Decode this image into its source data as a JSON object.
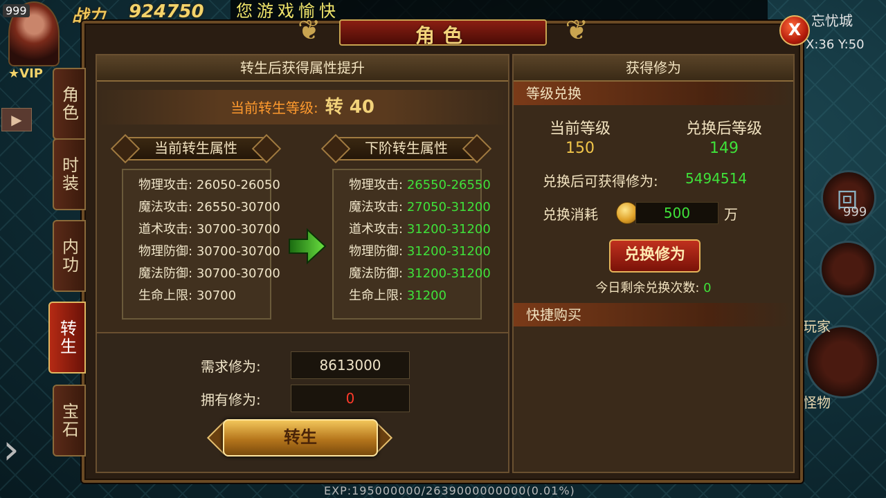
{
  "hud": {
    "level_badge": "999",
    "power_label": "战力",
    "power_value": "924750",
    "slogan": "您游戏愉快",
    "vip": "VIP",
    "city": "忘忧城",
    "coords": "X:36 Y:50",
    "player_label": "玩家",
    "monster_label": "怪物",
    "skill_count": "999",
    "exp": "EXP:195000000/2639000000000(0.01%)"
  },
  "window": {
    "title": "角色",
    "close_label": "X"
  },
  "tabs": [
    {
      "label": "角色",
      "active": false
    },
    {
      "label": "时装",
      "active": false
    },
    {
      "label": "内功",
      "active": false
    },
    {
      "label": "转生",
      "active": true
    },
    {
      "label": "宝石",
      "active": false
    }
  ],
  "rebirth": {
    "header": "转生后获得属性提升",
    "level_label": "当前转生等级:",
    "level_value": "转 40",
    "current_title": "当前转生属性",
    "next_title": "下阶转生属性",
    "current_attrs": [
      {
        "key": "物理攻击:",
        "value": "26050-26050"
      },
      {
        "key": "魔法攻击:",
        "value": "26550-30700"
      },
      {
        "key": "道术攻击:",
        "value": "30700-30700"
      },
      {
        "key": "物理防御:",
        "value": "30700-30700"
      },
      {
        "key": "魔法防御:",
        "value": "30700-30700"
      },
      {
        "key": "生命上限:",
        "value": "30700"
      }
    ],
    "next_attrs": [
      {
        "key": "物理攻击:",
        "value": "26550-26550"
      },
      {
        "key": "魔法攻击:",
        "value": "27050-31200"
      },
      {
        "key": "道术攻击:",
        "value": "31200-31200"
      },
      {
        "key": "物理防御:",
        "value": "31200-31200"
      },
      {
        "key": "魔法防御:",
        "value": "31200-31200"
      },
      {
        "key": "生命上限:",
        "value": "31200"
      }
    ],
    "required_label": "需求修为:",
    "required_value": "8613000",
    "owned_label": "拥有修为:",
    "owned_value": "0",
    "button_label": "转生"
  },
  "cultivation": {
    "header": "获得修为",
    "section_exchange": "等级兑换",
    "current_level_label": "当前等级",
    "after_level_label": "兑换后等级",
    "current_level_value": "150",
    "after_level_value": "149",
    "gain_label": "兑换后可获得修为:",
    "gain_value": "5494514",
    "cost_label": "兑换消耗",
    "cost_value": "500",
    "cost_unit": "万",
    "button_label": "兑换修为",
    "remaining_label": "今日剩余兑换次数:",
    "remaining_value": "0",
    "section_quick_buy": "快捷购买"
  },
  "colors": {
    "accent_gold": "#f2d27a",
    "highlight_orange": "#ff9a2e",
    "value_green": "#3fe23a",
    "value_red": "#ff3a2a"
  }
}
